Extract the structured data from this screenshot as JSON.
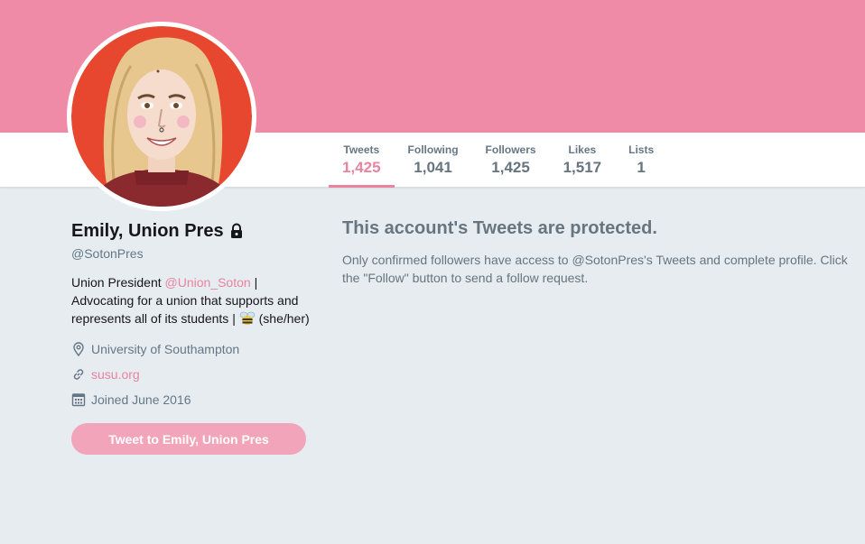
{
  "colors": {
    "banner": "#f08ba7",
    "accent": "#e8849f",
    "background": "#e6ecf0",
    "button": "#f2a5ba"
  },
  "stats": [
    {
      "label": "Tweets",
      "value": "1,425",
      "active": true
    },
    {
      "label": "Following",
      "value": "1,041"
    },
    {
      "label": "Followers",
      "value": "1,425"
    },
    {
      "label": "Likes",
      "value": "1,517"
    },
    {
      "label": "Lists",
      "value": "1"
    }
  ],
  "profile": {
    "name": "Emily, Union Pres",
    "handle": "@SotonPres",
    "bio_prefix": "Union President ",
    "bio_mention": "@Union_Soton",
    "bio_rest": " | Advocating for a union that supports and represents all of its students | ",
    "bio_suffix": " (she/her)",
    "location": "University of Southampton",
    "website": "susu.org",
    "joined": "Joined June 2016",
    "tweet_to_label": "Tweet to Emily, Union Pres"
  },
  "protected": {
    "title": "This account's Tweets are protected.",
    "body": "Only confirmed followers have access to @SotonPres's Tweets and complete profile. Click the \"Follow\" button to send a follow request."
  },
  "icons": {
    "lock": "lock-icon",
    "bee": "bee-icon",
    "location": "location-pin-icon",
    "link": "link-icon",
    "calendar": "calendar-icon"
  }
}
